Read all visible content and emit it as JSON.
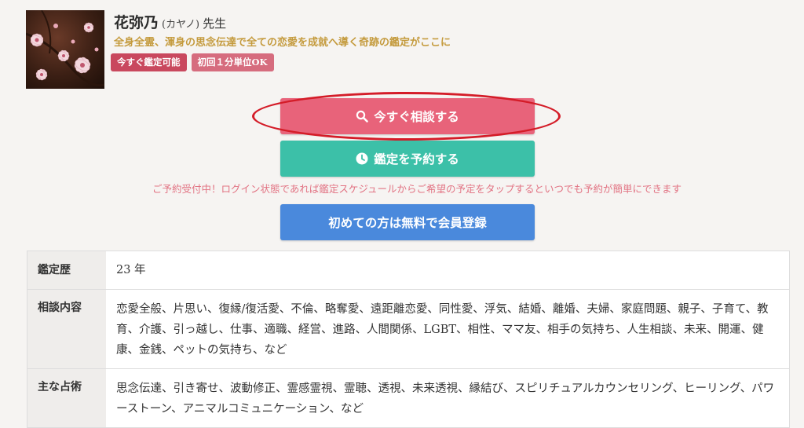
{
  "profile": {
    "name": "花弥乃",
    "kana": "(カヤノ)",
    "suffix": "先生",
    "tagline": "全身全霊、渾身の思念伝達で全ての恋愛を成就へ導く奇跡の鑑定がここに",
    "photo_icon": "cherry-blossom-photo",
    "badges": [
      {
        "label": "今すぐ鑑定可能",
        "color": "#c9485e"
      },
      {
        "label": "初回１分単位OK",
        "color": "#d66c7e"
      }
    ]
  },
  "actions": {
    "consult_label": "今すぐ相談する",
    "consult_icon": "search-icon",
    "consult_color": "#e8637a",
    "reserve_label": "鑑定を予約する",
    "reserve_icon": "clock-icon",
    "reserve_color": "#3cc0a8",
    "notice": "ご予約受付中！ログイン状態であれば鑑定スケジュールからご希望の予定をタップするといつでも予約が簡単にできます",
    "register_label": "初めての方は無料で会員登録",
    "register_color": "#4a89dc",
    "highlight_color": "#d41c28"
  },
  "info": {
    "rows": [
      {
        "label": "鑑定歴",
        "value": "23 年"
      },
      {
        "label": "相談内容",
        "value": "恋愛全般、片思い、復縁/復活愛、不倫、略奪愛、遠距離恋愛、同性愛、浮気、結婚、離婚、夫婦、家庭問題、親子、子育て、教育、介護、引っ越し、仕事、適職、経営、進路、人間関係、LGBT、相性、ママ友、相手の気持ち、人生相談、未来、開運、健康、金銭、ペットの気持ち、など"
      },
      {
        "label": "主な占術",
        "value": "思念伝達、引き寄せ、波動修正、霊感霊視、霊聴、透視、未来透視、縁結び、スピリチュアルカウンセリング、ヒーリング、パワーストーン、アニマルコミュニケーション、など"
      }
    ]
  }
}
